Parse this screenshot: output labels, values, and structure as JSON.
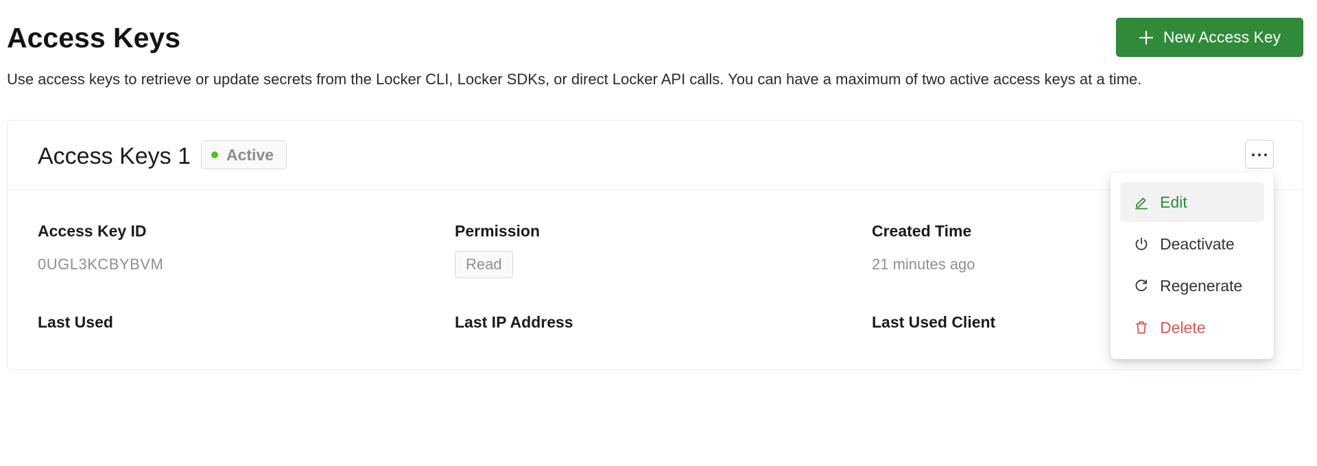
{
  "header": {
    "title": "Access Keys",
    "new_button_label": "New Access Key",
    "description": "Use access keys to retrieve or update secrets from the Locker CLI, Locker SDKs, or direct Locker API calls. You can have a maximum of two active access keys at a time."
  },
  "card": {
    "title": "Access Keys 1",
    "status": "Active",
    "fields": {
      "access_key_id_label": "Access Key ID",
      "access_key_id_value": "0UGL3KCBYBVM",
      "permission_label": "Permission",
      "permission_value": "Read",
      "created_time_label": "Created Time",
      "created_time_value": "21 minutes ago",
      "last_used_label": "Last Used",
      "last_ip_label": "Last IP Address",
      "last_client_label": "Last Used Client"
    }
  },
  "menu": {
    "items": [
      {
        "label": "Edit",
        "icon": "pencil-icon"
      },
      {
        "label": "Deactivate",
        "icon": "power-icon"
      },
      {
        "label": "Regenerate",
        "icon": "refresh-icon"
      },
      {
        "label": "Delete",
        "icon": "trash-icon"
      }
    ]
  },
  "colors": {
    "primary": "#2f8a3a",
    "status_active": "#52c41a",
    "danger": "#e05656",
    "muted_text": "#8f8f8f"
  }
}
